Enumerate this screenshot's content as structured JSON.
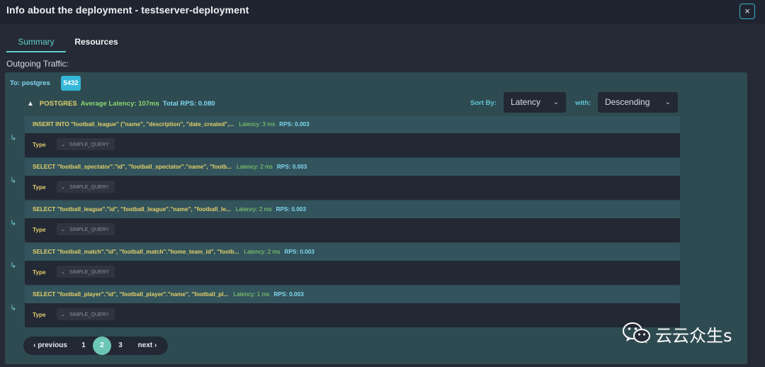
{
  "window": {
    "title": "Info about the deployment - testserver-deployment",
    "close_icon": "×"
  },
  "tabs": [
    {
      "label": "Summary",
      "active": true
    },
    {
      "label": "Resources",
      "active": false
    }
  ],
  "section": {
    "title": "Outgoing Traffic:"
  },
  "target": {
    "label": "To: postgres",
    "port": "5432"
  },
  "database": {
    "name": "POSTGRES",
    "avg_latency": "Average Latency: 107ms",
    "total_rps": "Total RPS: 0.080"
  },
  "sort": {
    "label": "Sort By:",
    "value": "Latency",
    "with_label": "with:",
    "order": "Descending"
  },
  "queries": [
    {
      "text": "INSERT INTO \"football_league\" (\"name\", \"description\", \"date_created\",...",
      "latency": "Latency: 3 ms",
      "rps": "RPS: 0.003",
      "type_label": "Type",
      "type_value": "SIMPLE_QUERY"
    },
    {
      "text": "SELECT \"football_spectator\".\"id\", \"football_spectator\".\"name\", \"footb...",
      "latency": "Latency: 2 ms",
      "rps": "RPS: 0.003",
      "type_label": "Type",
      "type_value": "SIMPLE_QUERY"
    },
    {
      "text": "SELECT \"football_league\".\"id\", \"football_league\".\"name\", \"football_le...",
      "latency": "Latency: 2 ms",
      "rps": "RPS: 0.003",
      "type_label": "Type",
      "type_value": "SIMPLE_QUERY"
    },
    {
      "text": "SELECT \"football_match\".\"id\", \"football_match\".\"home_team_id\", \"footb...",
      "latency": "Latency: 2 ms",
      "rps": "RPS: 0.003",
      "type_label": "Type",
      "type_value": "SIMPLE_QUERY"
    },
    {
      "text": "SELECT \"football_player\".\"id\", \"football_player\".\"name\", \"football_pl...",
      "latency": "Latency: 1 ms",
      "rps": "RPS: 0.003",
      "type_label": "Type",
      "type_value": "SIMPLE_QUERY"
    }
  ],
  "pagination": {
    "previous": "previous",
    "pages": [
      "1",
      "2",
      "3"
    ],
    "current": "2",
    "next": "next"
  },
  "watermark": {
    "text": "云云众生s"
  },
  "colors": {
    "accent": "#5fd0c6",
    "query_text": "#e4cf69",
    "latency": "#8ad870",
    "rps": "#7fd7f0",
    "port_badge": "#35b8d8",
    "active_page": "#6cc6b5"
  }
}
